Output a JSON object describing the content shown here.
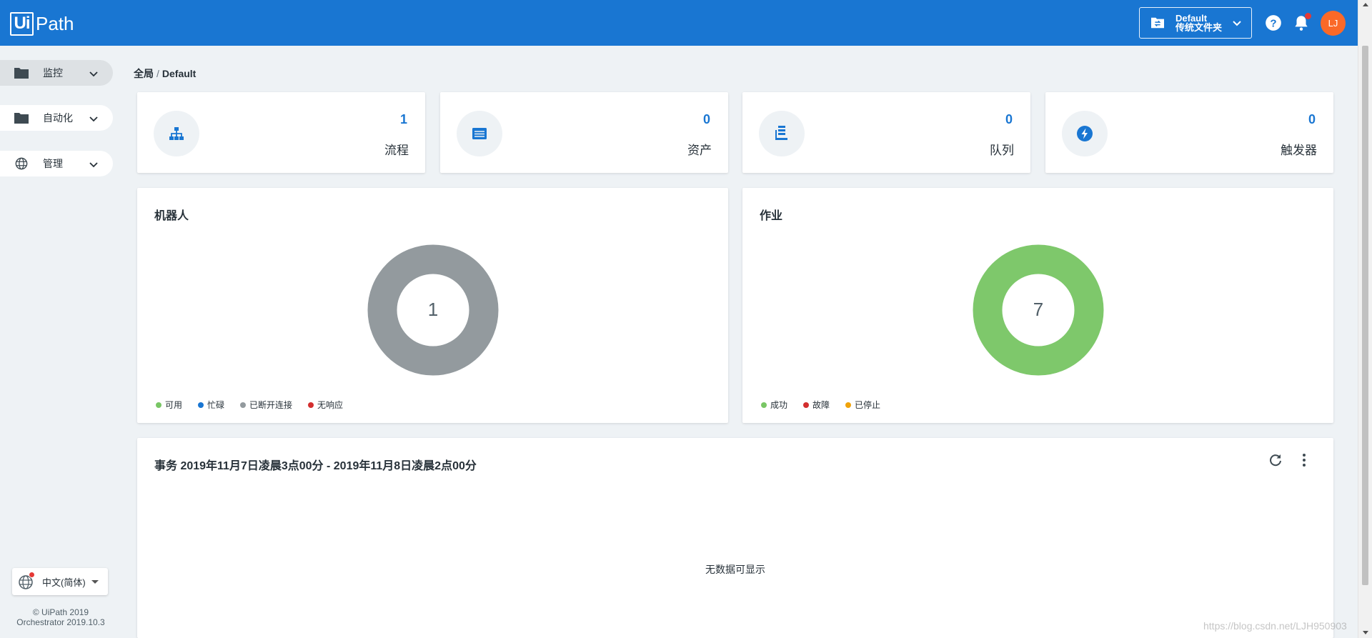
{
  "header": {
    "logo_box": "Ui",
    "logo_text": "Path",
    "folder": {
      "name": "Default",
      "type": "传统文件夹",
      "icon": "folder-swap-icon"
    },
    "help_icon": "help-circle-icon",
    "bell_icon": "bell-icon",
    "avatar_initials": "LJ",
    "colors": {
      "bar": "#1976d2",
      "avatar": "#fa6928",
      "badge": "#e53935"
    }
  },
  "sidebar": {
    "items": [
      {
        "label": "监控",
        "icon": "folder-icon",
        "active": true
      },
      {
        "label": "自动化",
        "icon": "folder-icon",
        "active": false
      },
      {
        "label": "管理",
        "icon": "globe-icon",
        "active": false
      }
    ],
    "language": "中文(简体)",
    "copyright": "© UiPath 2019",
    "version": "Orchestrator 2019.10.3"
  },
  "breadcrumb": {
    "root": "全局",
    "separator": "/",
    "current": "Default"
  },
  "stats": [
    {
      "value": "1",
      "label": "流程",
      "icon": "sitemap-icon"
    },
    {
      "value": "0",
      "label": "资产",
      "icon": "asset-list-icon"
    },
    {
      "value": "0",
      "label": "队列",
      "icon": "queue-icon"
    },
    {
      "value": "0",
      "label": "触发器",
      "icon": "lightning-icon"
    }
  ],
  "robots": {
    "title": "机器人",
    "center": "1",
    "color": "#939a9e",
    "legend": [
      {
        "label": "可用",
        "color": "#79c665"
      },
      {
        "label": "忙碌",
        "color": "#1976d2"
      },
      {
        "label": "已断开连接",
        "color": "#939a9e"
      },
      {
        "label": "无响应",
        "color": "#d32f2f"
      }
    ]
  },
  "jobs": {
    "title": "作业",
    "center": "7",
    "color": "#7ec86b",
    "legend": [
      {
        "label": "成功",
        "color": "#79c665"
      },
      {
        "label": "故障",
        "color": "#d32f2f"
      },
      {
        "label": "已停止",
        "color": "#f0a30a"
      }
    ]
  },
  "transactions": {
    "title": "事务 2019年11月7日凌晨3点00分 - 2019年11月8日凌晨2点00分",
    "empty": "无数据可显示",
    "refresh_icon": "refresh-icon",
    "more_icon": "more-vert-icon"
  },
  "watermark": "https://blog.csdn.net/LJH950903"
}
